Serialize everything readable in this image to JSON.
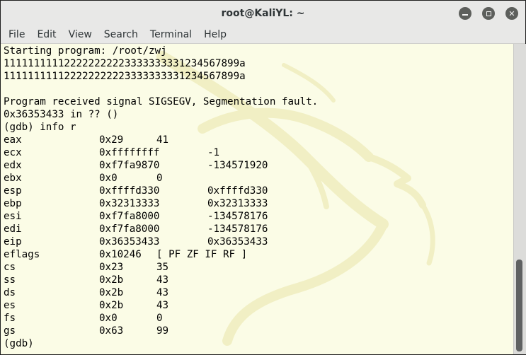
{
  "window": {
    "title": "root@KaliYL: ~",
    "buttons": {
      "minimize": "minimize-icon",
      "maximize": "maximize-icon",
      "close": "close-icon"
    }
  },
  "menu": [
    "File",
    "Edit",
    "View",
    "Search",
    "Terminal",
    "Help"
  ],
  "terminal": {
    "lines": [
      "Starting program: /root/zwj",
      "111111111122222222223333333331234567899a",
      "111111111122222222223333333331234567899a",
      "",
      "Program received signal SIGSEGV, Segmentation fault.",
      "0x36353433 in ?? ()",
      "(gdb) info r"
    ],
    "registers": [
      {
        "name": "eax",
        "hex": "0x29",
        "value": "41"
      },
      {
        "name": "ecx",
        "hex": "0xffffffff",
        "value": "-1"
      },
      {
        "name": "edx",
        "hex": "0xf7fa9870",
        "value": "-134571920"
      },
      {
        "name": "ebx",
        "hex": "0x0",
        "value": "0"
      },
      {
        "name": "esp",
        "hex": "0xffffd330",
        "value": "0xffffd330"
      },
      {
        "name": "ebp",
        "hex": "0x32313333",
        "value": "0x32313333"
      },
      {
        "name": "esi",
        "hex": "0xf7fa8000",
        "value": "-134578176"
      },
      {
        "name": "edi",
        "hex": "0xf7fa8000",
        "value": "-134578176"
      },
      {
        "name": "eip",
        "hex": "0x36353433",
        "value": "0x36353433"
      },
      {
        "name": "eflags",
        "hex": "0x10246",
        "value": "[ PF ZF IF RF ]"
      },
      {
        "name": "cs",
        "hex": "0x23",
        "value": "35"
      },
      {
        "name": "ss",
        "hex": "0x2b",
        "value": "43"
      },
      {
        "name": "ds",
        "hex": "0x2b",
        "value": "43"
      },
      {
        "name": "es",
        "hex": "0x2b",
        "value": "43"
      },
      {
        "name": "fs",
        "hex": "0x0",
        "value": "0"
      },
      {
        "name": "gs",
        "hex": "0x63",
        "value": "99"
      }
    ],
    "prompt": "(gdb)"
  },
  "colors": {
    "terminal_bg": "#fbfce6",
    "text": "#000000",
    "dragon": "#f1efc4"
  }
}
